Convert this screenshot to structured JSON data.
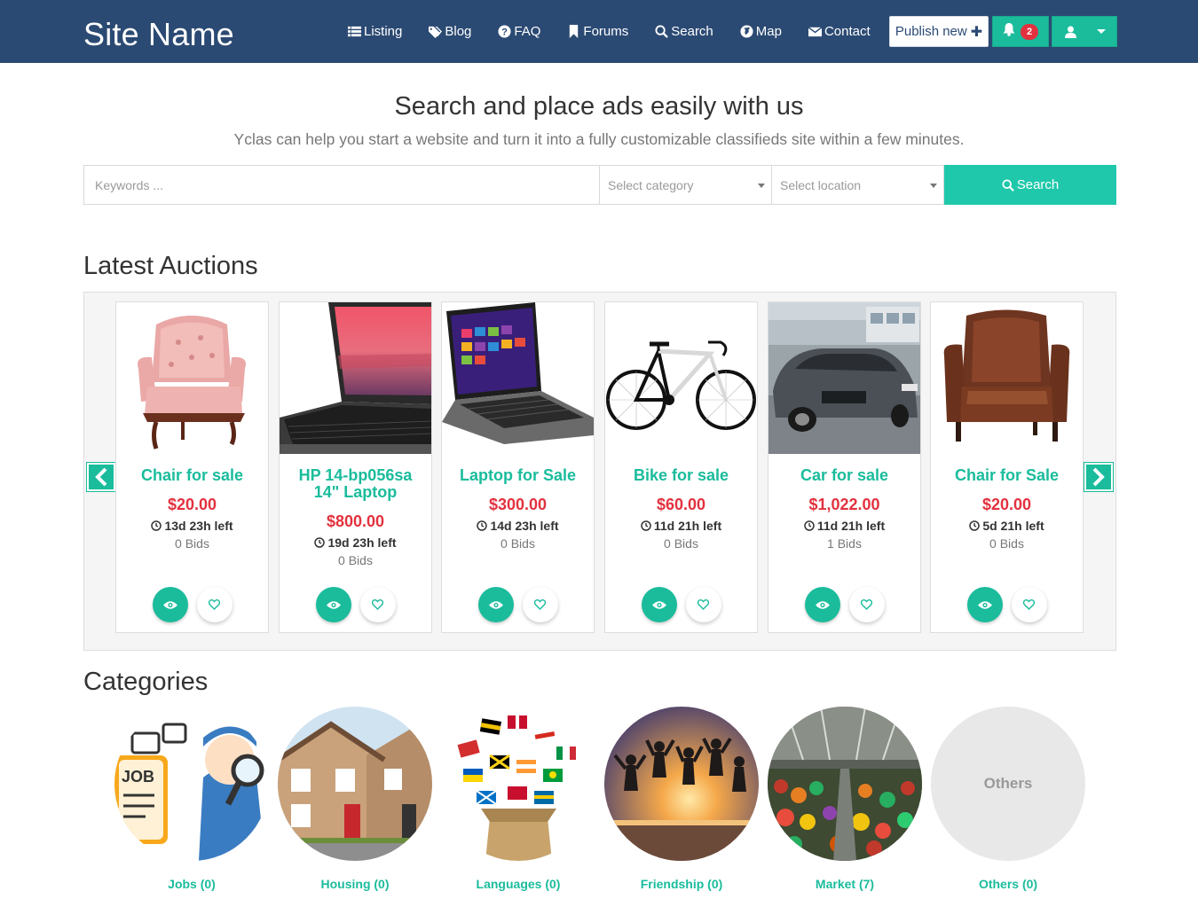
{
  "navbar": {
    "brand": "Site Name",
    "links": [
      {
        "label": "Listing",
        "icon": "list-icon"
      },
      {
        "label": "Blog",
        "icon": "tags-icon"
      },
      {
        "label": "FAQ",
        "icon": "question-icon"
      },
      {
        "label": "Forums",
        "icon": "bookmark-icon"
      },
      {
        "label": "Search",
        "icon": "search-icon"
      },
      {
        "label": "Map",
        "icon": "globe-icon"
      },
      {
        "label": "Contact",
        "icon": "envelope-icon"
      }
    ],
    "publish_label": "Publish new",
    "notification_count": "2"
  },
  "hero": {
    "title": "Search and place ads easily with us",
    "subtitle": "Yclas can help you start a website and turn it into a fully customizable classifieds site within a few minutes."
  },
  "search": {
    "keywords_placeholder": "Keywords ...",
    "category_placeholder": "Select category",
    "location_placeholder": "Select location",
    "button_label": "Search"
  },
  "auctions": {
    "heading": "Latest Auctions",
    "items": [
      {
        "title": "Chair for sale",
        "price": "$20.00",
        "time_left": "13d 23h left",
        "bids": "0 Bids",
        "image": "pink-armchair"
      },
      {
        "title": "HP 14-bp056sa 14\" Laptop",
        "price": "$800.00",
        "time_left": "19d 23h left",
        "bids": "0 Bids",
        "image": "laptop-sunset"
      },
      {
        "title": "Laptop for Sale",
        "price": "$300.00",
        "time_left": "14d 23h left",
        "bids": "0 Bids",
        "image": "laptop-windows"
      },
      {
        "title": "Bike for sale",
        "price": "$60.00",
        "time_left": "11d 21h left",
        "bids": "0 Bids",
        "image": "bicycle"
      },
      {
        "title": "Car for sale",
        "price": "$1,022.00",
        "time_left": "11d 21h left",
        "bids": "1 Bids",
        "image": "car"
      },
      {
        "title": "Chair for Sale",
        "price": "$20.00",
        "time_left": "5d 21h left",
        "bids": "0 Bids",
        "image": "leather-armchair"
      }
    ]
  },
  "categories": {
    "heading": "Categories",
    "items": [
      {
        "label": "Jobs (0)",
        "image": "jobs"
      },
      {
        "label": "Housing (0)",
        "image": "houses"
      },
      {
        "label": "Languages (0)",
        "image": "flags"
      },
      {
        "label": "Friendship (0)",
        "image": "friends-jumping"
      },
      {
        "label": "Market (7)",
        "image": "market"
      },
      {
        "label": "Others (0)",
        "image": "placeholder",
        "placeholder_text": "Others"
      }
    ]
  },
  "colors": {
    "navbar": "#2b4a73",
    "accent": "#1abc9c",
    "price": "#e3313f"
  }
}
